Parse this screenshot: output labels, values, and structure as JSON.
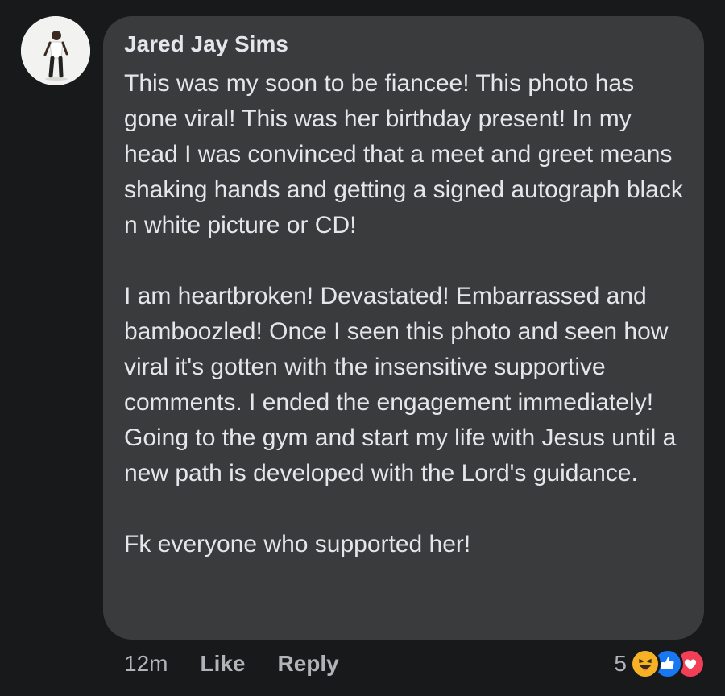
{
  "comment": {
    "author": "Jared Jay Sims",
    "paragraphs": [
      "This was my soon to be fiancee! This photo has gone viral! This was her birthday present! In my head I was convinced that a meet and greet means shaking hands and getting a signed autograph black n white picture or CD!",
      "I am heartbroken! Devastated! Embarrassed and bamboozled! Once I seen this photo and seen how viral it's gotten with the insensitive supportive comments. I ended the engagement immediately! Going to the gym and start my life with Jesus until a new path is developed with the Lord's guidance.",
      "Fk everyone who supported her!"
    ]
  },
  "actions": {
    "time": "12m",
    "like_label": "Like",
    "reply_label": "Reply"
  },
  "reactions": {
    "count": "5",
    "icons": [
      "haha-icon",
      "like-icon",
      "love-icon"
    ]
  },
  "colors": {
    "background": "#18191b",
    "bubble": "#3a3b3c",
    "text": "#e4e6eb",
    "secondary_text": "#b0b3b8",
    "like_blue": "#1877f2",
    "love_red": "#f33e58",
    "haha_yellow": "#f7b125"
  }
}
